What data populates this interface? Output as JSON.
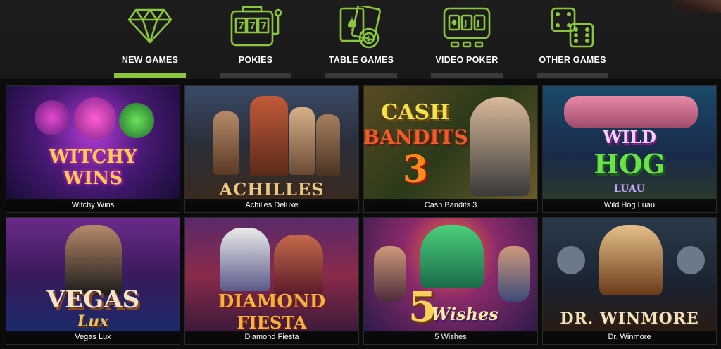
{
  "colors": {
    "accent": "#8cc63f",
    "inactive_bar": "#3a3a3a",
    "background": "#0b0b0b",
    "nav_bg": "#1b1b1b"
  },
  "nav": {
    "items": [
      {
        "label": "NEW GAMES",
        "icon": "diamond-icon",
        "active": true
      },
      {
        "label": "POKIES",
        "icon": "slot-machine-icon",
        "active": false
      },
      {
        "label": "TABLE GAMES",
        "icon": "cards-chip-icon",
        "active": false
      },
      {
        "label": "VIDEO POKER",
        "icon": "video-poker-icon",
        "active": false
      },
      {
        "label": "OTHER GAMES",
        "icon": "dice-icon",
        "active": false
      }
    ]
  },
  "games": [
    {
      "title": "Witchy Wins",
      "logo_line1": "WITCHY",
      "logo_line2": "WINS"
    },
    {
      "title": "Achilles Deluxe",
      "logo_line1": "ACHILLES",
      "logo_line2": ""
    },
    {
      "title": "Cash Bandits 3",
      "logo_line1": "CASH",
      "logo_line2": "BANDITS",
      "logo_line3": "3"
    },
    {
      "title": "Wild Hog Luau",
      "logo_line1": "WILD",
      "logo_line2": "HOG",
      "logo_line3": "LUAU"
    },
    {
      "title": "Vegas Lux",
      "logo_line1": "VEGAS",
      "logo_line2": "Lux"
    },
    {
      "title": "Diamond Fiesta",
      "logo_line1": "DIAMOND",
      "logo_line2": "FIESTA"
    },
    {
      "title": "5 Wishes",
      "logo_line1": "5",
      "logo_line2": "Wishes"
    },
    {
      "title": "Dr. Winmore",
      "logo_line1": "DR. WINMORE",
      "logo_line2": ""
    }
  ]
}
